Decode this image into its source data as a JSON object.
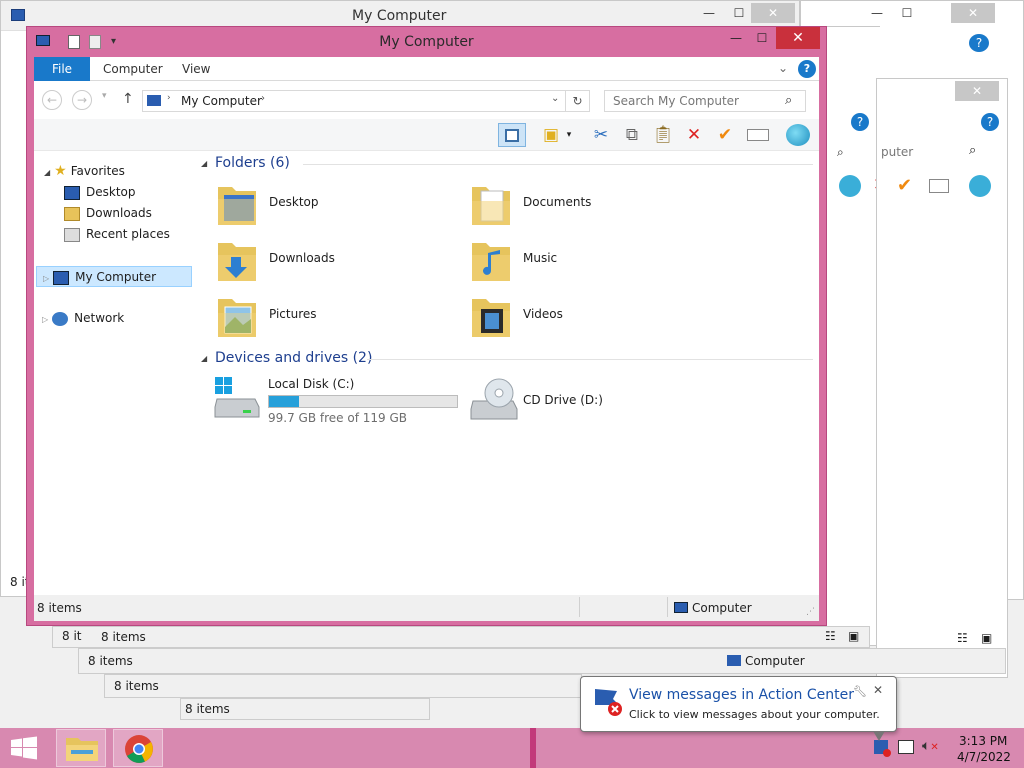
{
  "window_title": "My Computer",
  "ribbon_tabs": [
    "File",
    "Computer",
    "View"
  ],
  "address": {
    "path": "My Computer",
    "search_placeholder": "Search My Computer"
  },
  "nav": {
    "favorites": "Favorites",
    "items": [
      "Desktop",
      "Downloads",
      "Recent places"
    ],
    "my_computer": "My Computer",
    "network": "Network"
  },
  "folders_header": "Folders (6)",
  "folders": [
    "Desktop",
    "Documents",
    "Downloads",
    "Music",
    "Pictures",
    "Videos"
  ],
  "devices_header": "Devices and drives (2)",
  "drives": {
    "local": {
      "name": "Local Disk (C:)",
      "free": "99.7 GB free of 119 GB",
      "used_fraction": 0.16
    },
    "cd": {
      "name": "CD Drive (D:)"
    }
  },
  "status": {
    "items": "8 items",
    "location": "Computer"
  },
  "bg": {
    "title": "My Computer",
    "search_fragment": "puter",
    "items_a": "8 it",
    "items_b": "8 items",
    "items_c": "8 items",
    "items_d": "8 items",
    "items_e": "8 items",
    "items_f": "8 it",
    "computer_a": "Computer",
    "computer_b": "omputer"
  },
  "balloon": {
    "title": "View messages in Action Center",
    "body": "Click to view messages about your computer."
  },
  "clock": {
    "time": "3:13 PM",
    "date": "4/7/2022"
  },
  "colors": {
    "accent": "#1979ca",
    "frame": "#d76ea1",
    "close": "#c9303c",
    "taskbar": "#d889b0"
  }
}
